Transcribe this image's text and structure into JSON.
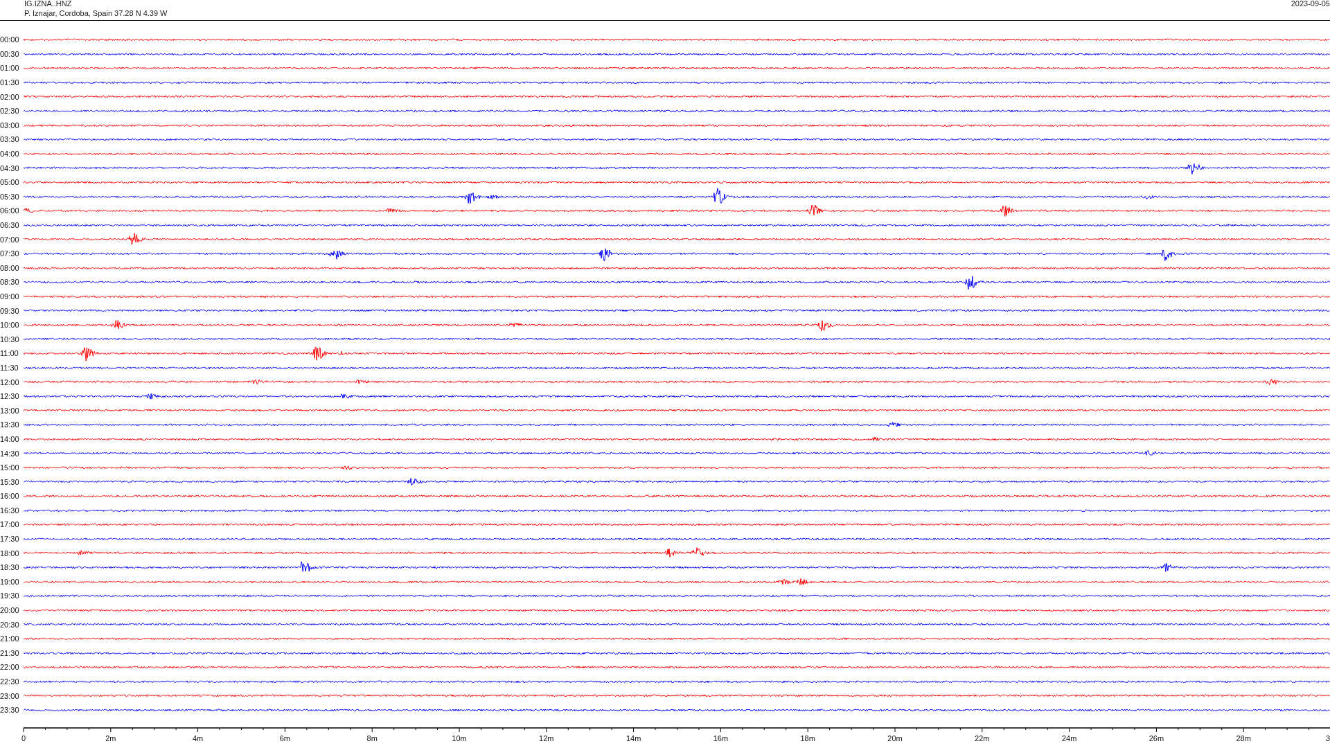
{
  "header": {
    "station": "IG.IZNA..HNZ",
    "location": "P. Iznajar, Cordoba, Spain  37.28 N 4.39 W",
    "date": "2023-09-05"
  },
  "rows": [
    {
      "time": "00:00",
      "color": "#ff0000"
    },
    {
      "time": "00:30",
      "color": "#0000ff"
    },
    {
      "time": "01:00",
      "color": "#ff0000"
    },
    {
      "time": "01:30",
      "color": "#0000ff"
    },
    {
      "time": "02:00",
      "color": "#ff0000"
    },
    {
      "time": "02:30",
      "color": "#0000ff"
    },
    {
      "time": "03:00",
      "color": "#ff0000"
    },
    {
      "time": "03:30",
      "color": "#0000ff"
    },
    {
      "time": "04:00",
      "color": "#ff0000"
    },
    {
      "time": "04:30",
      "color": "#0000ff"
    },
    {
      "time": "05:00",
      "color": "#ff0000"
    },
    {
      "time": "05:30",
      "color": "#0000ff"
    },
    {
      "time": "06:00",
      "color": "#ff0000"
    },
    {
      "time": "06:30",
      "color": "#0000ff"
    },
    {
      "time": "07:00",
      "color": "#ff0000"
    },
    {
      "time": "07:30",
      "color": "#0000ff"
    },
    {
      "time": "08:00",
      "color": "#ff0000"
    },
    {
      "time": "08:30",
      "color": "#0000ff"
    },
    {
      "time": "09:00",
      "color": "#ff0000"
    },
    {
      "time": "09:30",
      "color": "#0000ff"
    },
    {
      "time": "10:00",
      "color": "#ff0000"
    },
    {
      "time": "10:30",
      "color": "#0000ff"
    },
    {
      "time": "11:00",
      "color": "#ff0000"
    },
    {
      "time": "11:30",
      "color": "#0000ff"
    },
    {
      "time": "12:00",
      "color": "#ff0000"
    },
    {
      "time": "12:30",
      "color": "#0000ff"
    },
    {
      "time": "13:00",
      "color": "#ff0000"
    },
    {
      "time": "13:30",
      "color": "#0000ff"
    },
    {
      "time": "14:00",
      "color": "#ff0000"
    },
    {
      "time": "14:30",
      "color": "#0000ff"
    },
    {
      "time": "15:00",
      "color": "#ff0000"
    },
    {
      "time": "15:30",
      "color": "#0000ff"
    },
    {
      "time": "16:00",
      "color": "#ff0000"
    },
    {
      "time": "16:30",
      "color": "#0000ff"
    },
    {
      "time": "17:00",
      "color": "#ff0000"
    },
    {
      "time": "17:30",
      "color": "#0000ff"
    },
    {
      "time": "18:00",
      "color": "#ff0000"
    },
    {
      "time": "18:30",
      "color": "#0000ff"
    },
    {
      "time": "19:00",
      "color": "#ff0000"
    },
    {
      "time": "19:30",
      "color": "#0000ff"
    },
    {
      "time": "20:00",
      "color": "#ff0000"
    },
    {
      "time": "20:30",
      "color": "#0000ff"
    },
    {
      "time": "21:00",
      "color": "#ff0000"
    },
    {
      "time": "21:30",
      "color": "#0000ff"
    },
    {
      "time": "22:00",
      "color": "#ff0000"
    },
    {
      "time": "22:30",
      "color": "#0000ff"
    },
    {
      "time": "23:00",
      "color": "#ff0000"
    },
    {
      "time": "23:30",
      "color": "#0000ff"
    }
  ],
  "x_axis": {
    "ticks": [
      "0",
      "2m",
      "4m",
      "6m",
      "8m",
      "10m",
      "12m",
      "14m",
      "16m",
      "18m",
      "20m",
      "22m",
      "24m",
      "26m",
      "28m",
      "3"
    ]
  }
}
